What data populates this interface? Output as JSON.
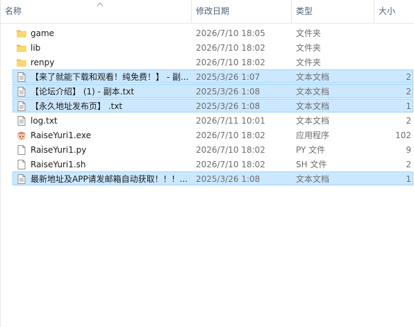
{
  "columns": {
    "name": "名称",
    "date": "修改日期",
    "type": "类型",
    "size": "大小"
  },
  "files": [
    {
      "name": "game",
      "date": "2026/7/10 18:05",
      "type": "文件夹",
      "size": "",
      "icon": "folder-icon",
      "selected": false
    },
    {
      "name": "lib",
      "date": "2026/7/10 18:02",
      "type": "文件夹",
      "size": "",
      "icon": "folder-icon",
      "selected": false
    },
    {
      "name": "renpy",
      "date": "2026/7/10 18:02",
      "type": "文件夹",
      "size": "",
      "icon": "folder-icon",
      "selected": false
    },
    {
      "name": "【来了就能下载和观看！纯免费！】 - 副...",
      "date": "2025/3/26 1:07",
      "type": "文本文档",
      "size": "2",
      "icon": "text-file-icon",
      "selected": true
    },
    {
      "name": "【论坛介绍】 (1) - 副本.txt",
      "date": "2025/3/26 1:08",
      "type": "文本文档",
      "size": "2",
      "icon": "text-file-icon",
      "selected": true
    },
    {
      "name": "【永久地址发布页】 .txt",
      "date": "2025/3/26 1:08",
      "type": "文本文档",
      "size": "1",
      "icon": "text-file-icon",
      "selected": true
    },
    {
      "name": "log.txt",
      "date": "2026/7/11 10:01",
      "type": "文本文档",
      "size": "2",
      "icon": "text-file-icon",
      "selected": false
    },
    {
      "name": "RaiseYuri1.exe",
      "date": "2026/7/10 18:02",
      "type": "应用程序",
      "size": "102",
      "icon": "app-icon",
      "selected": false
    },
    {
      "name": "RaiseYuri1.py",
      "date": "2026/7/10 18:02",
      "type": "PY 文件",
      "size": "9",
      "icon": "file-icon",
      "selected": false
    },
    {
      "name": "RaiseYuri1.sh",
      "date": "2026/7/10 18:02",
      "type": "SH 文件",
      "size": "2",
      "icon": "file-icon",
      "selected": false
    },
    {
      "name": "最新地址及APP请发邮箱自动获取！！！...",
      "date": "2025/3/26 1:08",
      "type": "文本文档",
      "size": "1",
      "icon": "text-file-icon",
      "selected": true
    }
  ],
  "colors": {
    "selection_bg": "#cce8ff",
    "selection_border": "#99d1ff",
    "header_text": "#4c607a",
    "folder": "#f8d775"
  }
}
